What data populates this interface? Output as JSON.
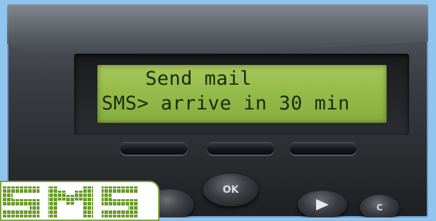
{
  "display": {
    "line1": "Send mail",
    "line2": "SMS> arrive in 30 min"
  },
  "buttons": {
    "ok_label": "OK",
    "clear_label": "C"
  },
  "logo": {
    "text": "SMS"
  },
  "colors": {
    "lcd_background": "#94b948",
    "lcd_text": "#1a2a10",
    "device_body": "#2b2d31",
    "page_background": "#8fc4ee",
    "logo_text": "#6a9a2a"
  },
  "icons": {
    "play_button": "play-triangle-icon"
  }
}
